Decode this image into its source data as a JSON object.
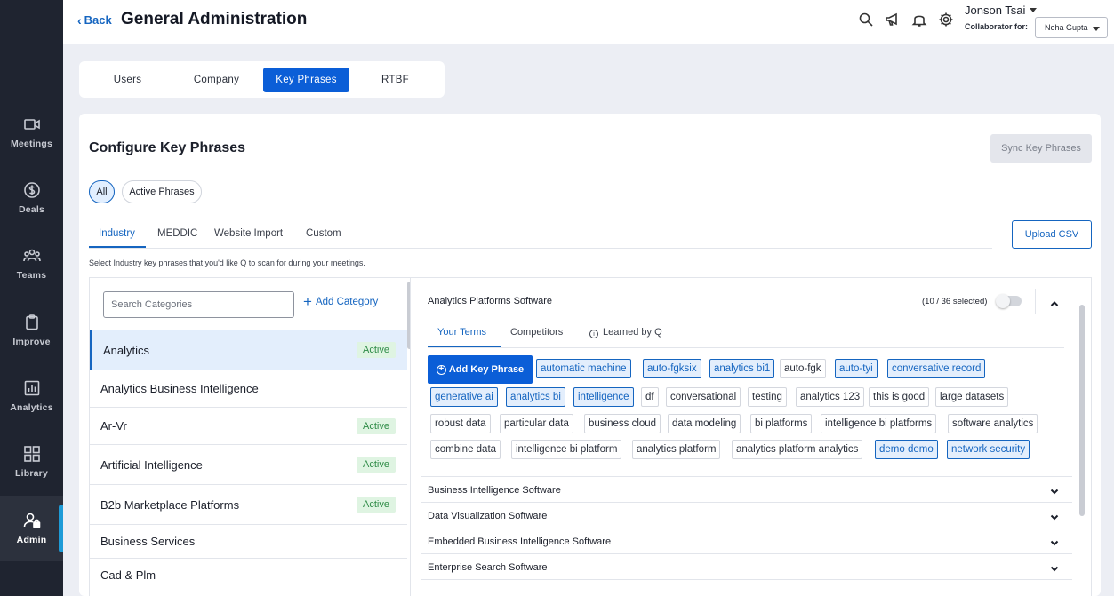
{
  "sidebar": {
    "items": [
      {
        "label": "Meetings",
        "icon": "video-camera-icon"
      },
      {
        "label": "Deals",
        "icon": "dollar-icon"
      },
      {
        "label": "Teams",
        "icon": "team-icon"
      },
      {
        "label": "Improve",
        "icon": "clipboard-icon"
      },
      {
        "label": "Analytics",
        "icon": "bar-chart-icon"
      },
      {
        "label": "Library",
        "icon": "grid-icon"
      },
      {
        "label": "Admin",
        "icon": "admin-lock-icon"
      }
    ],
    "active": "Admin"
  },
  "header": {
    "back_label": "Back",
    "title": "General Administration",
    "user_name": "Jonson Tsai",
    "collaborator_label": "Collaborator for:",
    "collaborator_value": "Neha Gupta"
  },
  "top_tabs": [
    "Users",
    "Company",
    "Key Phrases",
    "RTBF"
  ],
  "top_tab_active": "Key Phrases",
  "main": {
    "title": "Configure Key Phrases",
    "sync_label": "Sync Key Phrases",
    "filters": [
      "All",
      "Active Phrases"
    ],
    "sub_tabs": [
      "Industry",
      "MEDDIC",
      "Website Import",
      "Custom"
    ],
    "upload_label": "Upload CSV",
    "helper_text": "Select Industry key phrases that you'd like Q to scan for during your meetings."
  },
  "categories": {
    "search_placeholder": "Search Categories",
    "add_label": "Add Category",
    "active_badge": "Active",
    "items": [
      {
        "name": "Analytics",
        "active": true
      },
      {
        "name": "Analytics Business Intelligence",
        "active": false
      },
      {
        "name": "Ar-Vr",
        "active": true
      },
      {
        "name": "Artificial Intelligence",
        "active": true
      },
      {
        "name": "B2b Marketplace Platforms",
        "active": true
      },
      {
        "name": "Business Services",
        "active": false
      },
      {
        "name": "Cad & Plm",
        "active": false
      }
    ]
  },
  "detail": {
    "title": "Analytics Platforms Software",
    "selected_count": "(10 / 36 selected)",
    "term_tabs": [
      "Your Terms",
      "Competitors",
      "Learned by Q"
    ],
    "add_label": "Add Key Phrase",
    "terms": [
      {
        "text": "automatic machine",
        "selected": true
      },
      {
        "text": "auto-fgksix",
        "selected": true
      },
      {
        "text": "analytics bi1",
        "selected": true
      },
      {
        "text": "auto-fgk",
        "selected": false
      },
      {
        "text": "auto-tyi",
        "selected": true
      },
      {
        "text": "conversative record",
        "selected": true
      },
      {
        "text": "generative ai",
        "selected": true
      },
      {
        "text": "analytics bi",
        "selected": true
      },
      {
        "text": "intelligence",
        "selected": true
      },
      {
        "text": "df",
        "selected": false
      },
      {
        "text": "conversational",
        "selected": false
      },
      {
        "text": "testing",
        "selected": false
      },
      {
        "text": "analytics 123",
        "selected": false
      },
      {
        "text": "this is good",
        "selected": false
      },
      {
        "text": "large datasets",
        "selected": false
      },
      {
        "text": "robust data",
        "selected": false
      },
      {
        "text": "particular data",
        "selected": false
      },
      {
        "text": "business cloud",
        "selected": false
      },
      {
        "text": "data modeling",
        "selected": false
      },
      {
        "text": "bi platforms",
        "selected": false
      },
      {
        "text": "intelligence bi platforms",
        "selected": false
      },
      {
        "text": "software analytics",
        "selected": false
      },
      {
        "text": "combine data",
        "selected": false
      },
      {
        "text": "intelligence bi platform",
        "selected": false
      },
      {
        "text": "analytics platform",
        "selected": false
      },
      {
        "text": "analytics platform analytics",
        "selected": false
      },
      {
        "text": "demo demo",
        "selected": true
      },
      {
        "text": "network security",
        "selected": true
      }
    ],
    "other_sections": [
      "Business Intelligence Software",
      "Data Visualization Software",
      "Embedded Business Intelligence Software",
      "Enterprise Search Software"
    ]
  },
  "colors": {
    "accent": "#0b5ed7",
    "active_badge_bg": "#dff4e2",
    "active_badge_text": "#2e8b46",
    "sidebar_bg": "#1f2430"
  }
}
